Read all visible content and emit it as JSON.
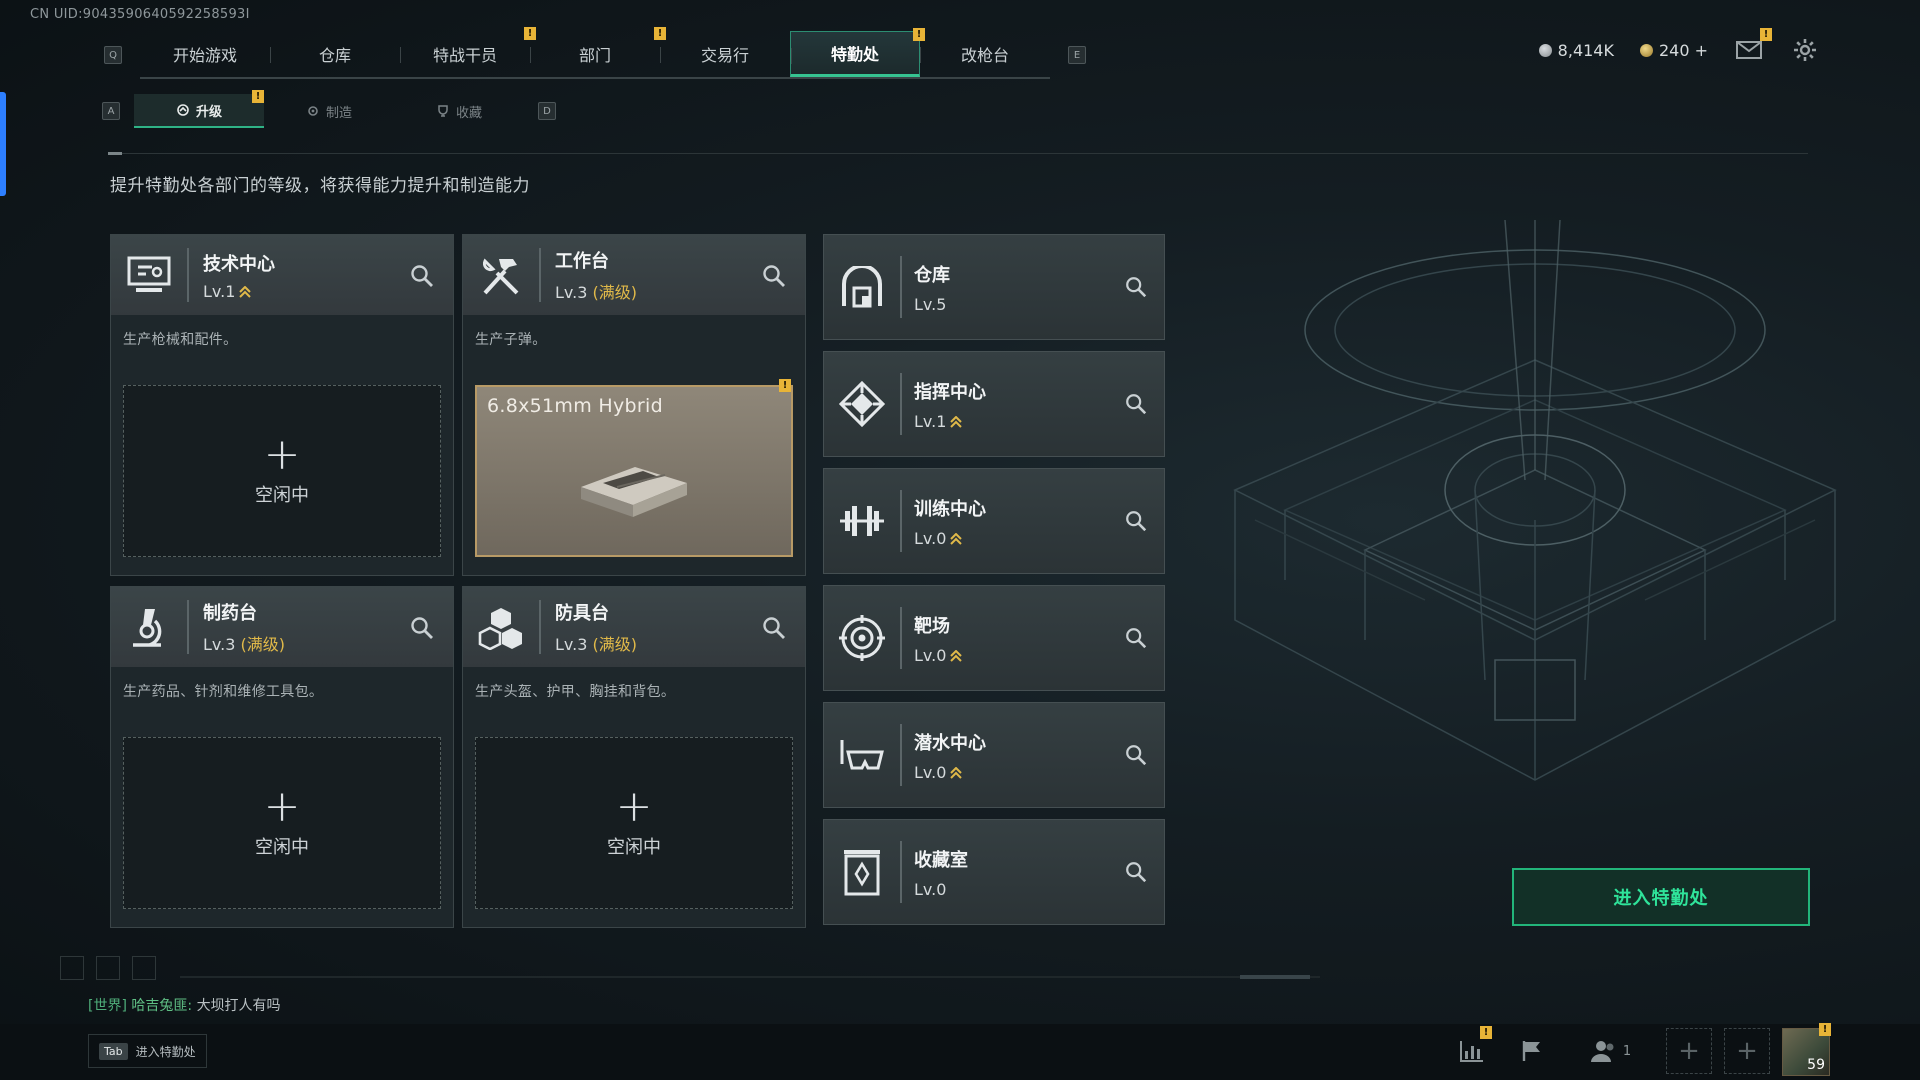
{
  "uid": "CN UID:9043590640592258593I",
  "nav": {
    "left_key": "Q",
    "right_key": "E",
    "tabs": [
      {
        "label": "开始游戏",
        "badge": ""
      },
      {
        "label": "仓库",
        "badge": ""
      },
      {
        "label": "特战干员",
        "badge": "!"
      },
      {
        "label": "部门",
        "badge": "!"
      },
      {
        "label": "交易行",
        "badge": ""
      },
      {
        "label": "特勤处",
        "badge": "!",
        "active": true
      },
      {
        "label": "改枪台",
        "badge": ""
      }
    ]
  },
  "currency": {
    "silver": "8,414K",
    "gold": "240 +",
    "mail_badge": "!"
  },
  "subnav": {
    "left_key": "A",
    "right_key": "D",
    "tabs": [
      {
        "label": "升级",
        "badge": "!",
        "active": true
      },
      {
        "label": "制造",
        "badge": ""
      },
      {
        "label": "收藏",
        "badge": ""
      }
    ]
  },
  "description": "提升特勤处各部门的等级，将获得能力提升和制造能力",
  "facilities": [
    {
      "name": "技术中心",
      "level": "Lv.1",
      "max": "",
      "upgradable": true,
      "desc": "生产枪械和配件。",
      "slot_plus": "+",
      "slot_status": "空闲中"
    },
    {
      "name": "工作台",
      "level": "Lv.3",
      "max": "(满级)",
      "upgradable": false,
      "desc": "生产子弹。",
      "product": "6.8x51mm Hybrid",
      "product_badge": "!"
    },
    {
      "name": "制药台",
      "level": "Lv.3",
      "max": "(满级)",
      "upgradable": false,
      "desc": "生产药品、针剂和维修工具包。",
      "slot_plus": "+",
      "slot_status": "空闲中"
    },
    {
      "name": "防具台",
      "level": "Lv.3",
      "max": "(满级)",
      "upgradable": false,
      "desc": "生产头盔、护甲、胸挂和背包。",
      "slot_plus": "+",
      "slot_status": "空闲中"
    }
  ],
  "departments": [
    {
      "name": "仓库",
      "level": "Lv.5",
      "upgradable": false,
      "icon": "warehouse-icon"
    },
    {
      "name": "指挥中心",
      "level": "Lv.1",
      "upgradable": true,
      "icon": "command-icon"
    },
    {
      "name": "训练中心",
      "level": "Lv.0",
      "upgradable": true,
      "icon": "dumbbell-icon"
    },
    {
      "name": "靶场",
      "level": "Lv.0",
      "upgradable": true,
      "icon": "target-icon"
    },
    {
      "name": "潜水中心",
      "level": "Lv.0",
      "upgradable": true,
      "icon": "diving-mask-icon"
    },
    {
      "name": "收藏室",
      "level": "Lv.0",
      "upgradable": false,
      "icon": "collection-icon"
    }
  ],
  "enter_button": "进入特勤处",
  "chat": {
    "channel": "[世界]",
    "user": "哈吉兔匪:",
    "message": "大坝打人有吗"
  },
  "bottom": {
    "tab_key": "Tab",
    "tab_hint": "进入特勤处",
    "stats_badge": "!",
    "friends_count": "1",
    "plus": "+",
    "level": "59",
    "level_badge": "!"
  },
  "colors": {
    "accent_green": "#2fe39a",
    "badge_yellow": "#e8b437",
    "max_level_gold": "#e0b949"
  }
}
